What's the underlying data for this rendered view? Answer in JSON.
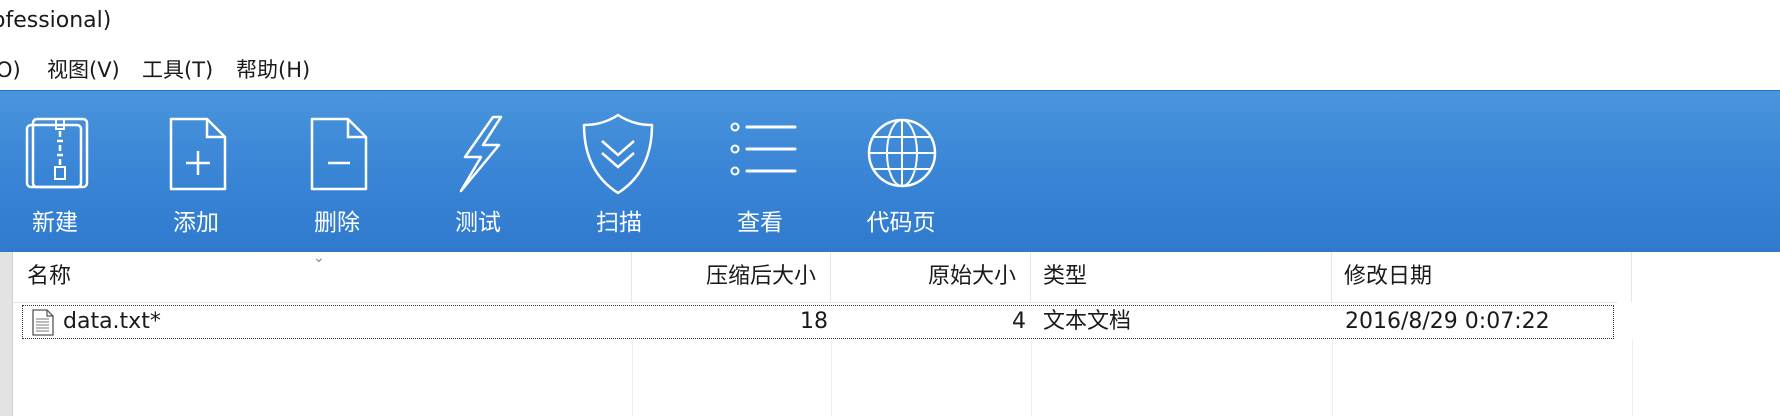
{
  "window": {
    "title": "ofessional)"
  },
  "menu": [
    {
      "label": "O)"
    },
    {
      "label": "视图(V)"
    },
    {
      "label": "工具(T)"
    },
    {
      "label": "帮助(H)"
    }
  ],
  "toolbar": {
    "buttons": [
      {
        "label": "新建",
        "icon": "archive-icon"
      },
      {
        "label": "添加",
        "icon": "add-file-icon"
      },
      {
        "label": "删除",
        "icon": "delete-file-icon"
      },
      {
        "label": "测试",
        "icon": "lightning-icon"
      },
      {
        "label": "扫描",
        "icon": "shield-icon"
      },
      {
        "label": "查看",
        "icon": "list-icon"
      },
      {
        "label": "代码页",
        "icon": "globe-icon"
      }
    ]
  },
  "table": {
    "columns": [
      {
        "label": "名称"
      },
      {
        "label": "压缩后大小"
      },
      {
        "label": "原始大小"
      },
      {
        "label": "类型"
      },
      {
        "label": "修改日期"
      }
    ],
    "rows": [
      {
        "name": "data.txt*",
        "compressed_size": "18",
        "original_size": "4",
        "type": "文本文档",
        "modified": "2016/8/29 0:07:22"
      }
    ]
  },
  "colors": {
    "toolbar_top": "#4a95dc",
    "toolbar_bottom": "#2f7acd"
  }
}
